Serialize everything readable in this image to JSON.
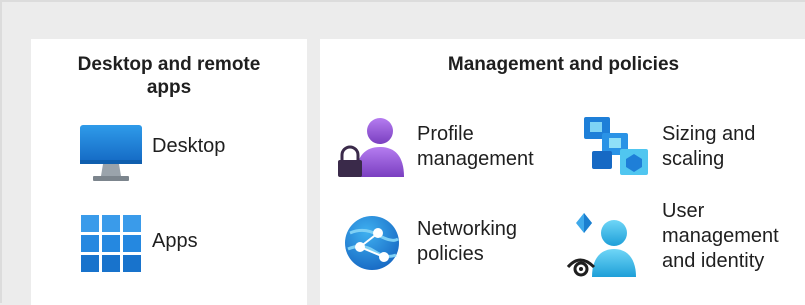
{
  "left_panel": {
    "title_line1": "Desktop and remote",
    "title_line2": "apps",
    "items": [
      {
        "label": "Desktop",
        "icon": "monitor-icon"
      },
      {
        "label": "Apps",
        "icon": "app-grid-icon"
      }
    ]
  },
  "right_panel": {
    "title": "Management and policies",
    "items": [
      {
        "label_line1": "Profile",
        "label_line2": "management",
        "icon": "user-lock-icon"
      },
      {
        "label_line1": "Sizing and",
        "label_line2": "scaling",
        "icon": "scaling-icon"
      },
      {
        "label_line1": "Networking",
        "label_line2": "policies",
        "icon": "network-icon"
      },
      {
        "label_line1": "User",
        "label_line2": "management",
        "label_line3": "and identity",
        "icon": "user-identity-icon"
      }
    ]
  },
  "colors": {
    "background": "#ececec",
    "panel": "#ffffff",
    "blue": "#1e88d8",
    "light_blue": "#50c6f0",
    "purple": "#8b4fc9"
  }
}
